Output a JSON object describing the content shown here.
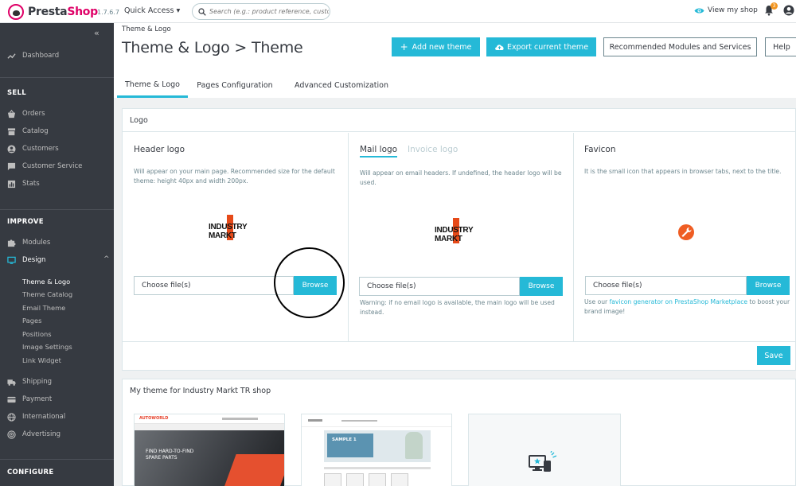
{
  "app": {
    "logo_presta": "Presta",
    "logo_shop": "Shop",
    "version": "1.7.6.7",
    "quick_access": "Quick Access",
    "search_placeholder": "Search (e.g.: product reference, custome",
    "view_my_shop": "View my shop",
    "notifications_count": "3"
  },
  "sidebar": {
    "dashboard": "Dashboard",
    "sell_title": "SELL",
    "sell_items": [
      "Orders",
      "Catalog",
      "Customers",
      "Customer Service",
      "Stats"
    ],
    "improve_title": "IMPROVE",
    "modules": "Modules",
    "design": "Design",
    "design_sub": [
      "Theme & Logo",
      "Theme Catalog",
      "Email Theme",
      "Pages",
      "Positions",
      "Image Settings",
      "Link Widget"
    ],
    "more_items": [
      "Shipping",
      "Payment",
      "International",
      "Advertising"
    ],
    "configure_title": "CONFIGURE"
  },
  "header": {
    "breadcrumb": "Theme & Logo",
    "title": "Theme & Logo > Theme",
    "add_theme": "Add new theme",
    "export_theme": "Export current theme",
    "recommended": "Recommended Modules and Services",
    "help": "Help",
    "tabs": [
      "Theme & Logo",
      "Pages Configuration",
      "Advanced Customization"
    ]
  },
  "logo_panel": {
    "title": "Logo",
    "header_logo": {
      "title": "Header logo",
      "desc": "Will appear on your main page. Recommended size for the default theme: height 40px and width 200px.",
      "file_placeholder": "Choose file(s)",
      "browse": "Browse"
    },
    "mail_logo": {
      "tab_mail": "Mail logo",
      "tab_invoice": "Invoice logo",
      "desc": "Will appear on email headers. If undefined, the header logo will be used.",
      "file_placeholder": "Choose file(s)",
      "browse": "Browse",
      "warning": "Warning: if no email logo is available, the main logo will be used instead."
    },
    "favicon": {
      "title": "Favicon",
      "desc": "It is the small icon that appears in browser tabs, next to the title.",
      "file_placeholder": "Choose file(s)",
      "browse": "Browse",
      "help_prefix": "Use our ",
      "help_link": "favicon generator on PrestaShop Marketplace",
      "help_suffix": " to boost your brand image!"
    },
    "logo_text": "INDUSTRY MARKT",
    "save": "Save"
  },
  "themes_panel": {
    "title": "My theme for Industry Markt TR shop",
    "card1_brand": "AUTOWORLD",
    "card1_hero": "FIND HARD-TO-FIND SPARE PARTS",
    "card2_hero": "SAMPLE 1"
  },
  "colors": {
    "accent": "#25b9d7",
    "sidebar_bg": "#363a41",
    "brand": "#df0067"
  }
}
